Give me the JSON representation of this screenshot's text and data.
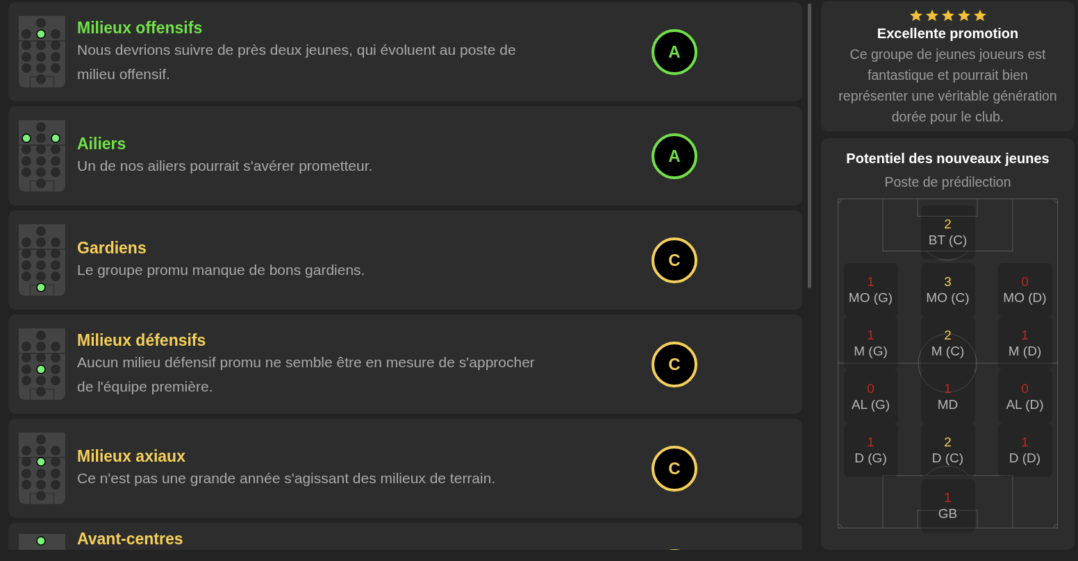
{
  "groups": [
    {
      "title": "Milieux offensifs",
      "description": "Nous devrions suivre de près deux jeunes, qui évoluent au poste de milieu offensif.",
      "grade": "A",
      "color": "#72e04a",
      "pitch": [
        [
          false
        ],
        [
          false,
          true,
          false
        ],
        [
          false,
          false,
          false
        ],
        [
          false,
          false,
          false
        ],
        [
          false,
          false,
          false
        ],
        [
          false
        ]
      ]
    },
    {
      "title": "Ailiers",
      "description": "Un de nos ailiers pourrait s'avérer prometteur.",
      "grade": "A",
      "color": "#72e04a",
      "pitch": [
        [
          false
        ],
        [
          true,
          false,
          true
        ],
        [
          false,
          false,
          false
        ],
        [
          false,
          false,
          false
        ],
        [
          false,
          false,
          false
        ],
        [
          false
        ]
      ]
    },
    {
      "title": "Gardiens",
      "description": "Le groupe promu manque de bons gardiens.",
      "grade": "C",
      "color": "#f5d05a",
      "pitch": [
        [
          false
        ],
        [
          false,
          false,
          false
        ],
        [
          false,
          false,
          false
        ],
        [
          false,
          false,
          false
        ],
        [
          false,
          false,
          false
        ],
        [
          true
        ]
      ]
    },
    {
      "title": "Milieux défensifs",
      "description": "Aucun milieu défensif promu ne semble être en mesure de s'approcher de l'équipe première.",
      "grade": "C",
      "color": "#f5d05a",
      "pitch": [
        [
          false
        ],
        [
          false,
          false,
          false
        ],
        [
          false,
          false,
          false
        ],
        [
          false,
          true,
          false
        ],
        [
          false,
          false,
          false
        ],
        [
          false
        ]
      ]
    },
    {
      "title": "Milieux axiaux",
      "description": "Ce n'est pas une grande année s'agissant des milieux de terrain.",
      "grade": "C",
      "color": "#f5d05a",
      "pitch": [
        [
          false
        ],
        [
          false,
          false,
          false
        ],
        [
          false,
          true,
          false
        ],
        [
          false,
          false,
          false
        ],
        [
          false,
          false,
          false
        ],
        [
          false
        ]
      ]
    },
    {
      "title": "Avant-centres",
      "color": "#f5d05a",
      "pitch": [
        [
          true
        ]
      ]
    }
  ],
  "summary": {
    "stars": 5,
    "title": "Excellente promotion",
    "description": "Ce groupe de jeunes joueurs est fantastique et pourrait bien représenter une véritable génération dorée pour le club."
  },
  "potential": {
    "title": "Potentiel des nouveaux jeunes",
    "subtitle": "Poste de prédilection",
    "rows": [
      [
        null,
        {
          "count": "2",
          "label": "BT (C)",
          "color": "#f0c850"
        },
        null
      ],
      [
        {
          "count": "1",
          "label": "MO (G)",
          "color": "#c0281e"
        },
        {
          "count": "3",
          "label": "MO (C)",
          "color": "#f0c850"
        },
        {
          "count": "0",
          "label": "MO (D)",
          "color": "#c0281e"
        }
      ],
      [
        {
          "count": "1",
          "label": "M (G)",
          "color": "#c0281e"
        },
        {
          "count": "2",
          "label": "M (C)",
          "color": "#f0c850"
        },
        {
          "count": "1",
          "label": "M (D)",
          "color": "#c0281e"
        }
      ],
      [
        {
          "count": "0",
          "label": "AL (G)",
          "color": "#c0281e"
        },
        {
          "count": "1",
          "label": "MD",
          "color": "#c0281e"
        },
        {
          "count": "0",
          "label": "AL (D)",
          "color": "#c0281e"
        }
      ],
      [
        {
          "count": "1",
          "label": "D (G)",
          "color": "#c0281e"
        },
        {
          "count": "2",
          "label": "D (C)",
          "color": "#f0c850"
        },
        {
          "count": "1",
          "label": "D (D)",
          "color": "#c0281e"
        }
      ],
      [
        null,
        {
          "count": "1",
          "label": "GB",
          "color": "#c0281e"
        },
        null
      ]
    ]
  }
}
